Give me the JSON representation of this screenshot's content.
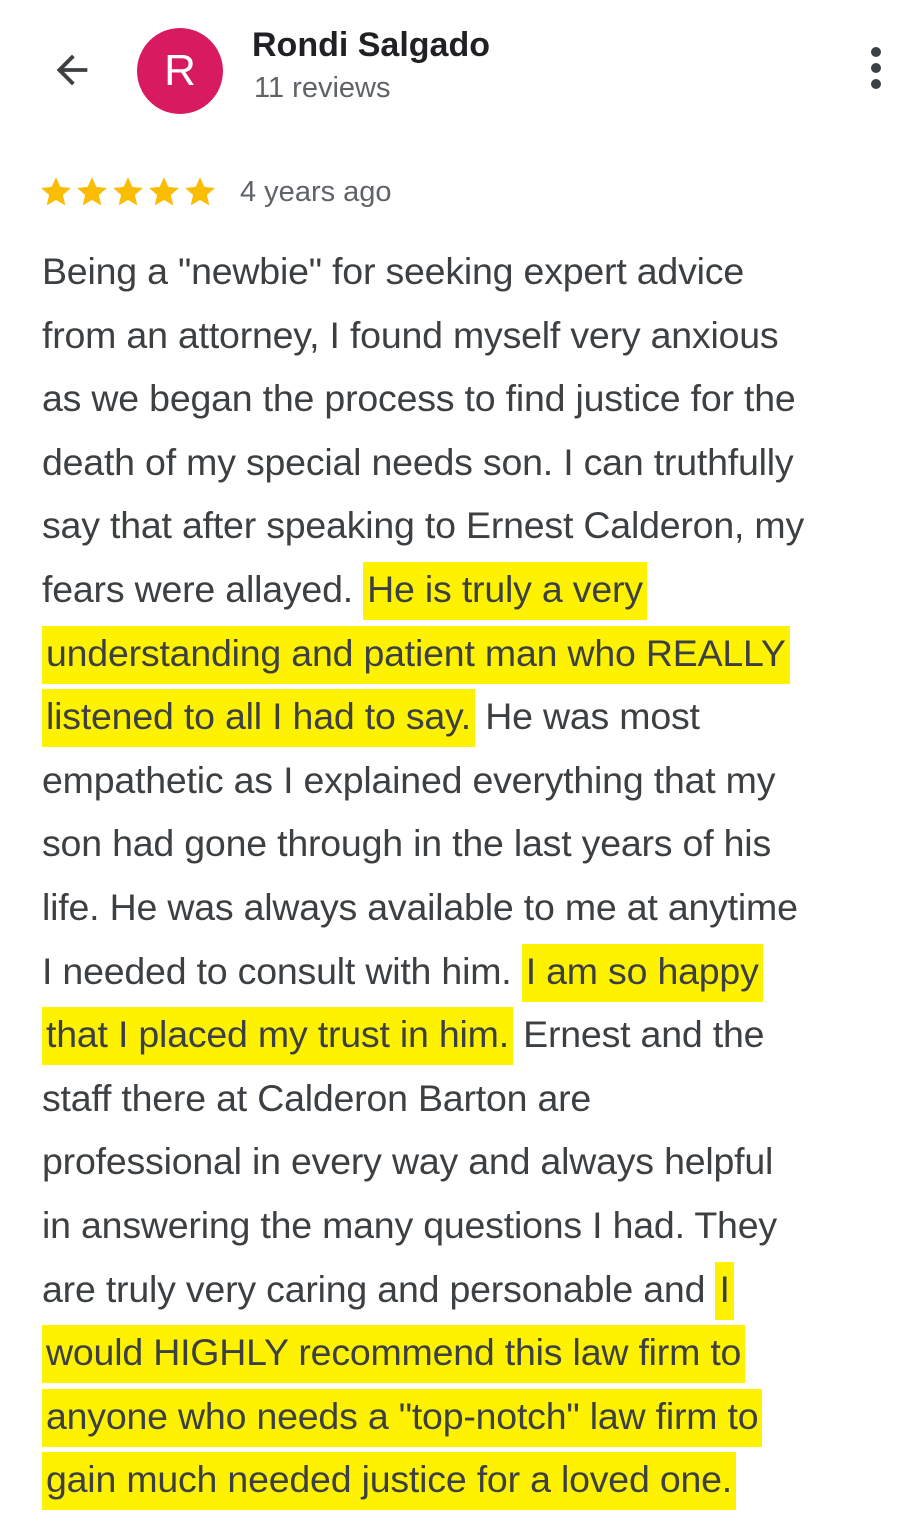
{
  "header": {
    "back_icon": "arrow-left-icon",
    "avatar_letter": "R",
    "avatar_color": "#d81b60",
    "user_name": "Rondi Salgado",
    "review_count": "11 reviews",
    "more_icon": "more-vertical-icon"
  },
  "review": {
    "rating": 5,
    "rating_max": 5,
    "star_color": "#fbbc04",
    "time_ago": "4 years ago",
    "highlight_color": "#fff200",
    "lines": [
      [
        {
          "t": "Being a \"newbie\" for seeking expert advice",
          "h": false
        }
      ],
      [
        {
          "t": "from an attorney, I found myself very anxious",
          "h": false
        }
      ],
      [
        {
          "t": "as we began the process to find justice for the",
          "h": false
        }
      ],
      [
        {
          "t": "death of my special needs son. I can truthfully",
          "h": false
        }
      ],
      [
        {
          "t": "say that after speaking to Ernest Calderon, my",
          "h": false
        }
      ],
      [
        {
          "t": "fears were allayed. ",
          "h": false
        },
        {
          "t": "He is truly a very",
          "h": true
        }
      ],
      [
        {
          "t": "understanding and patient man who REALLY",
          "h": true
        }
      ],
      [
        {
          "t": "listened to all I had to say.",
          "h": true
        },
        {
          "t": " He was most",
          "h": false
        }
      ],
      [
        {
          "t": "empathetic as I explained everything that my",
          "h": false
        }
      ],
      [
        {
          "t": "son had gone through in the last years of his",
          "h": false
        }
      ],
      [
        {
          "t": "life. He was always available to me at anytime",
          "h": false
        }
      ],
      [
        {
          "t": "I needed to consult with him. ",
          "h": false
        },
        {
          "t": "I am so happy",
          "h": true
        }
      ],
      [
        {
          "t": "that I placed my trust in him.",
          "h": true
        },
        {
          "t": " Ernest and the",
          "h": false
        }
      ],
      [
        {
          "t": "staff there at Calderon Barton are",
          "h": false
        }
      ],
      [
        {
          "t": "professional in every way and always helpful",
          "h": false
        }
      ],
      [
        {
          "t": "in answering the many questions I had. They",
          "h": false
        }
      ],
      [
        {
          "t": "are truly very caring and personable and ",
          "h": false
        },
        {
          "t": "I",
          "h": true
        }
      ],
      [
        {
          "t": "would HIGHLY recommend this law firm to",
          "h": true
        }
      ],
      [
        {
          "t": "anyone who needs a \"top-notch\" law firm to",
          "h": true
        }
      ],
      [
        {
          "t": "gain much needed justice for a loved one.",
          "h": true
        }
      ]
    ]
  }
}
